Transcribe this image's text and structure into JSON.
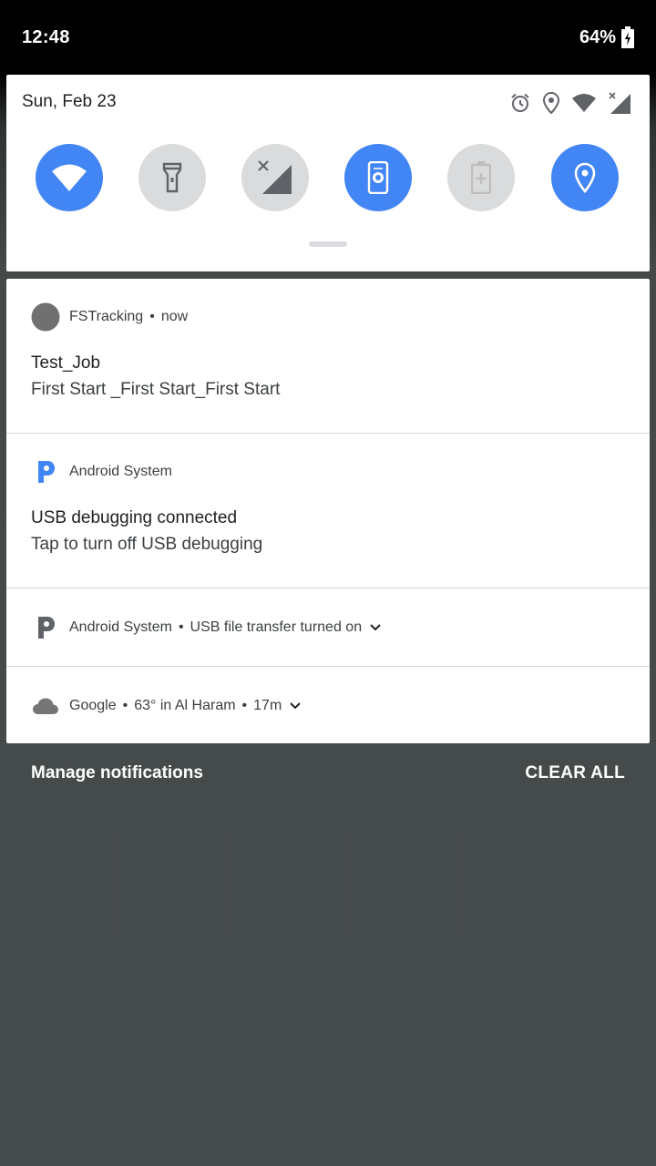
{
  "status_bar": {
    "time": "12:48",
    "battery_percent": "64%",
    "battery_icon": "battery-charging-icon"
  },
  "quick_settings": {
    "date": "Sun, Feb 23",
    "status_icons": [
      "alarm-icon",
      "location-icon",
      "wifi-icon",
      "no-signal-icon"
    ],
    "tiles": [
      {
        "name": "wifi",
        "icon": "wifi-icon",
        "state": "on"
      },
      {
        "name": "flashlight",
        "icon": "flashlight-icon",
        "state": "off"
      },
      {
        "name": "mobile-data",
        "icon": "no-signal-icon",
        "state": "off"
      },
      {
        "name": "auto-rotate",
        "icon": "auto-rotate-icon",
        "state": "on"
      },
      {
        "name": "battery-saver",
        "icon": "battery-saver-icon",
        "state": "off"
      },
      {
        "name": "location",
        "icon": "location-icon",
        "state": "on"
      }
    ],
    "accent_color": "#4285f4",
    "off_color": "#dadbdc"
  },
  "notifications": [
    {
      "app": "FSTracking",
      "time": "now",
      "icon": "app-placeholder-icon",
      "title": "Test_Job",
      "text": "First Start _First Start_First Start"
    },
    {
      "app": "Android System",
      "icon": "android-system-icon",
      "icon_color": "#4285f4",
      "title": "USB debugging connected",
      "text": "Tap to turn off USB debugging"
    },
    {
      "app": "Android System",
      "summary": "USB file transfer turned on",
      "icon": "android-system-icon",
      "icon_color": "#5f6368"
    },
    {
      "app": "Google",
      "summary": "63° in Al Haram",
      "time": "17m",
      "icon": "cloud-icon",
      "icon_color": "#757575"
    }
  ],
  "footer": {
    "manage_label": "Manage notifications",
    "clear_label": "CLEAR ALL"
  }
}
